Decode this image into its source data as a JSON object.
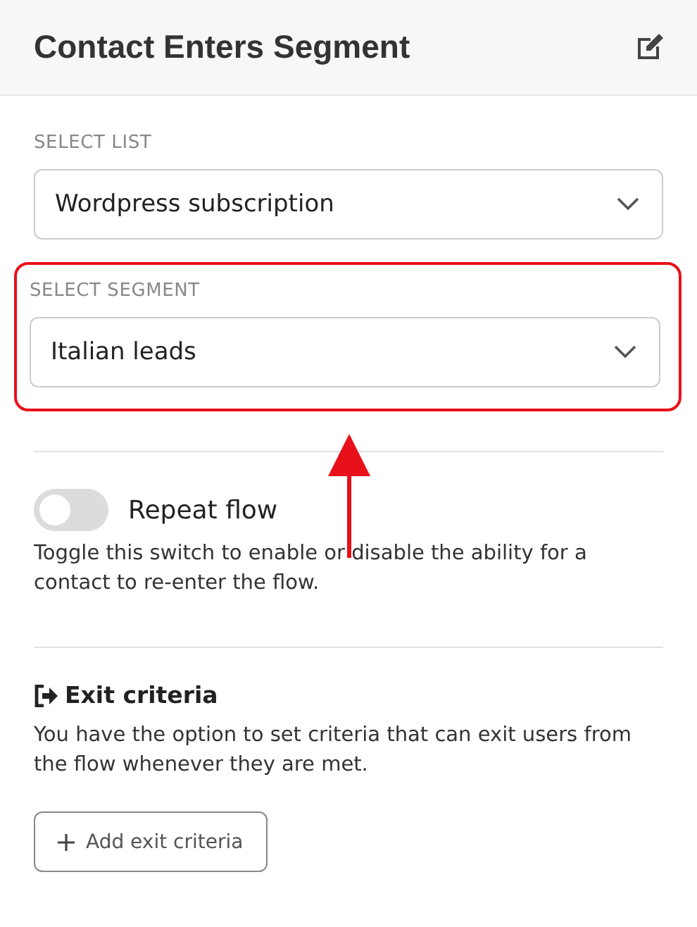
{
  "header": {
    "title": "Contact Enters Segment"
  },
  "selects": [
    {
      "label": "SELECT LIST",
      "value": "Wordpress subscription",
      "highlighted": false
    },
    {
      "label": "SELECT SEGMENT",
      "value": "Italian leads",
      "highlighted": true
    }
  ],
  "repeat": {
    "label": "Repeat flow",
    "on": false,
    "description": "Toggle this switch to enable or disable the ability for a contact to re-enter the flow."
  },
  "exit": {
    "title": "Exit criteria",
    "description": "You have the option to set criteria that can exit users from the flow whenever they are met.",
    "button": "Add exit criteria"
  }
}
